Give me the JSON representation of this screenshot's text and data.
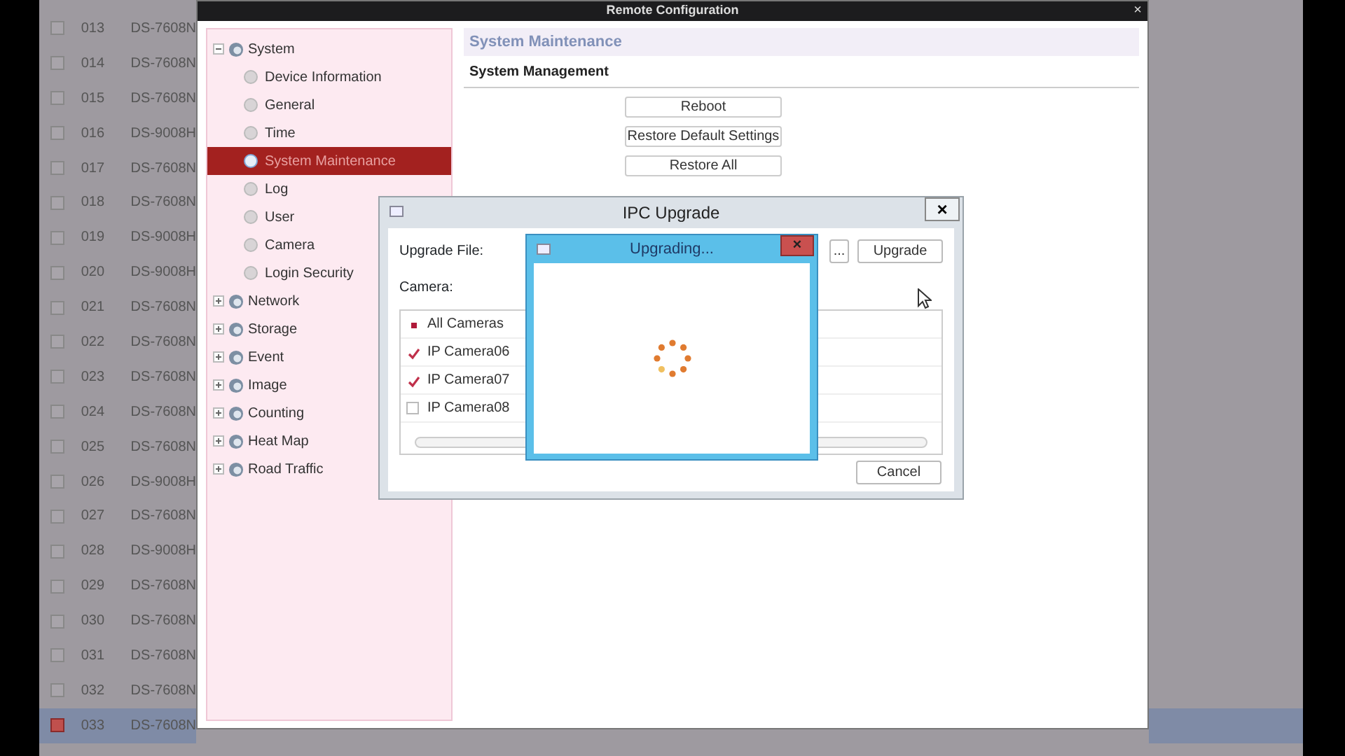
{
  "device_list": {
    "rows": [
      {
        "number": "013",
        "model": "DS-7608N",
        "selected": false
      },
      {
        "number": "014",
        "model": "DS-7608N",
        "selected": false
      },
      {
        "number": "015",
        "model": "DS-7608N",
        "selected": false
      },
      {
        "number": "016",
        "model": "DS-9008H",
        "selected": false
      },
      {
        "number": "017",
        "model": "DS-7608N",
        "selected": false
      },
      {
        "number": "018",
        "model": "DS-7608N",
        "selected": false
      },
      {
        "number": "019",
        "model": "DS-9008H",
        "selected": false
      },
      {
        "number": "020",
        "model": "DS-9008H",
        "selected": false
      },
      {
        "number": "021",
        "model": "DS-7608N",
        "selected": false
      },
      {
        "number": "022",
        "model": "DS-7608N",
        "selected": false
      },
      {
        "number": "023",
        "model": "DS-7608N",
        "selected": false
      },
      {
        "number": "024",
        "model": "DS-7608N",
        "selected": false
      },
      {
        "number": "025",
        "model": "DS-7608N",
        "selected": false
      },
      {
        "number": "026",
        "model": "DS-9008H",
        "selected": false
      },
      {
        "number": "027",
        "model": "DS-7608N",
        "selected": false
      },
      {
        "number": "028",
        "model": "DS-9008H",
        "selected": false
      },
      {
        "number": "029",
        "model": "DS-7608N",
        "selected": false
      },
      {
        "number": "030",
        "model": "DS-7608N",
        "selected": false
      },
      {
        "number": "031",
        "model": "DS-7608N",
        "selected": false
      },
      {
        "number": "032",
        "model": "DS-7608N",
        "selected": false
      },
      {
        "number": "033",
        "model": "DS-7608N",
        "selected": true
      }
    ]
  },
  "config_window": {
    "title": "Remote Configuration",
    "close": "×",
    "tree": [
      {
        "label": "System",
        "expanded": true,
        "children": [
          {
            "label": "Device Information",
            "selected": false
          },
          {
            "label": "General",
            "selected": false
          },
          {
            "label": "Time",
            "selected": false
          },
          {
            "label": "System Maintenance",
            "selected": true
          },
          {
            "label": "Log",
            "selected": false
          },
          {
            "label": "User",
            "selected": false
          },
          {
            "label": "Camera",
            "selected": false
          },
          {
            "label": "Login Security",
            "selected": false
          }
        ]
      },
      {
        "label": "Network",
        "expanded": false
      },
      {
        "label": "Storage",
        "expanded": false
      },
      {
        "label": "Event",
        "expanded": false
      },
      {
        "label": "Image",
        "expanded": false
      },
      {
        "label": "Counting",
        "expanded": false
      },
      {
        "label": "Heat Map",
        "expanded": false
      },
      {
        "label": "Road Traffic",
        "expanded": false
      }
    ],
    "section_title": "System Maintenance",
    "subsection": "System Management",
    "buttons": [
      "Reboot",
      "Restore Default Settings",
      "Restore All"
    ]
  },
  "upgrade_dialog": {
    "title": "IPC Upgrade",
    "close": "×",
    "file_label": "Upgrade File:",
    "browse": "...",
    "upgrade_button": "Upgrade",
    "camera_label": "Camera:",
    "all_cameras": {
      "label": "All Cameras",
      "partial": true
    },
    "cameras": [
      {
        "label": "IP Camera06",
        "checked": true
      },
      {
        "label": "IP Camera07",
        "checked": true
      },
      {
        "label": "IP Camera08",
        "checked": false
      }
    ],
    "cancel": "Cancel"
  },
  "progress_dialog": {
    "title": "Upgrading...",
    "close": "×"
  }
}
